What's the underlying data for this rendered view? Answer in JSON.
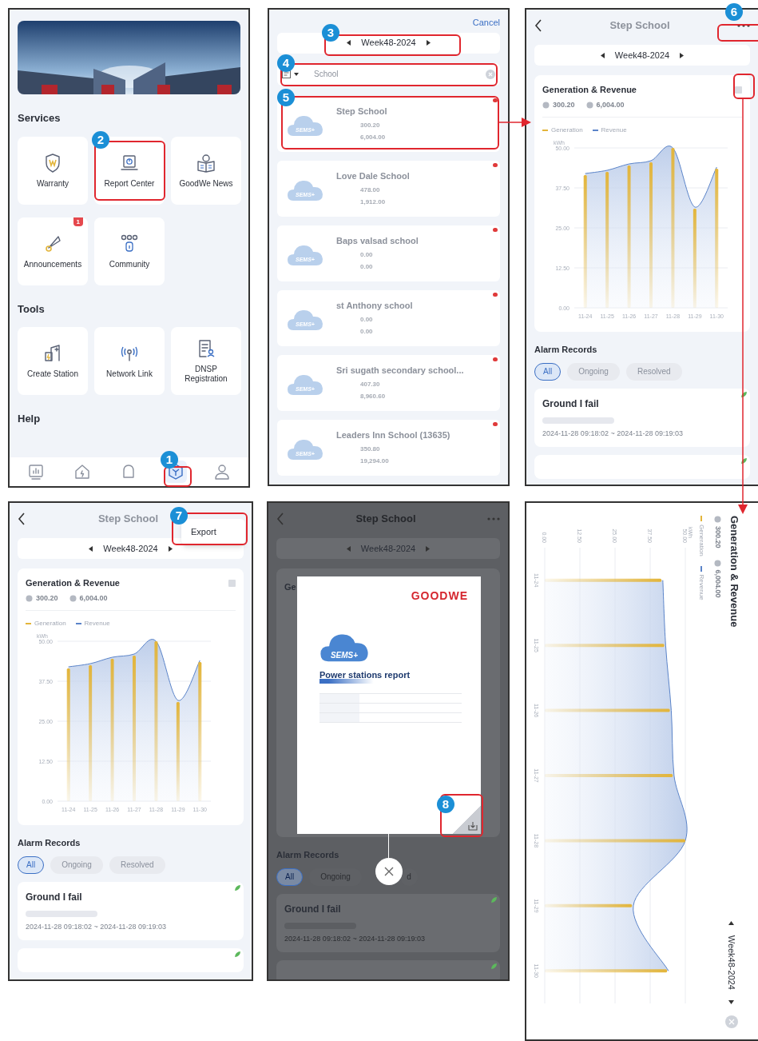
{
  "screens": [
    {
      "kind": "services",
      "banner": {
        "kind": "picture"
      },
      "sections": [
        {
          "title": "Services",
          "tiles": [
            {
              "label": "Warranty"
            },
            {
              "label": "Report Center"
            },
            {
              "label": "GoodWe News"
            },
            {
              "label": "Announcements",
              "badge": "1"
            },
            {
              "label": "Community"
            }
          ]
        },
        {
          "title": "Tools",
          "tiles": [
            {
              "label": "Create Station"
            },
            {
              "label": "Network Link"
            },
            {
              "label": "DNSP Registration"
            }
          ]
        },
        {
          "title": "Help"
        }
      ],
      "nav": [
        {
          "selected": false
        },
        {
          "selected": false
        },
        {
          "selected": false
        },
        {
          "selected": true
        },
        {
          "selected": false
        }
      ]
    },
    {
      "kind": "station_list",
      "cancel": "Cancel",
      "week": "Week48-2024",
      "search": {
        "value": "School"
      },
      "stations": [
        {
          "logo": "SEMS+",
          "name": "Step School",
          "generation": "300.20",
          "revenue": "6,004.00"
        },
        {
          "logo": "SEMS+",
          "name": "Love Dale School",
          "generation": "478.00",
          "revenue": "1,912.00"
        },
        {
          "logo": "SEMS+",
          "name": "Baps valsad school",
          "generation": "0.00",
          "revenue": "0.00"
        },
        {
          "logo": "SEMS+",
          "name": "st Anthony school",
          "generation": "0.00",
          "revenue": "0.00"
        },
        {
          "logo": "SEMS+",
          "name": "Sri sugath secondary school...",
          "generation": "407.30",
          "revenue": "8,960.60"
        },
        {
          "logo": "SEMS+",
          "name": "Leaders Inn School (13635)",
          "generation": "350.80",
          "revenue": "19,294.00"
        }
      ]
    },
    {
      "kind": "detail",
      "title": "Step School",
      "week": "Week48-2024",
      "card": {
        "title": "Generation & Revenue",
        "totals": [
          "300.20",
          "6,004.00"
        ],
        "chart_data": {
          "type": "bar",
          "grid": true,
          "ylabel": "kWh",
          "categories": [
            "11-24",
            "11-25",
            "11-26",
            "11-27",
            "11-28",
            "11-29",
            "11-30"
          ],
          "series": [
            {
              "name": "Generation",
              "type": "bar",
              "color": "#e3b53a",
              "values": [
                41.5,
                42.5,
                44.5,
                45.5,
                50,
                31,
                43.5
              ]
            },
            {
              "name": "Revenue",
              "type": "area",
              "color": "#5b84c9",
              "values": [
                42,
                43,
                45,
                46,
                50,
                31.5,
                44
              ]
            }
          ],
          "ylim": [
            0,
            50
          ],
          "yticks": [
            {
              "value": 0,
              "label": "0.00"
            },
            {
              "value": 12.5,
              "label": "12.50"
            },
            {
              "value": 25,
              "label": "25.00"
            },
            {
              "value": 37.5,
              "label": "37.50"
            },
            {
              "value": 50,
              "label": "50.00"
            }
          ]
        }
      },
      "alarms": {
        "title": "Alarm Records",
        "filters": [
          {
            "label": "All",
            "selected": true
          },
          {
            "label": "Ongoing",
            "selected": false
          },
          {
            "label": "Resolved",
            "selected": false
          }
        ],
        "records": [
          {
            "title": "Ground I fail",
            "time": "2024-11-28 09:18:02 ~ 2024-11-28 09:19:03"
          }
        ]
      }
    },
    {
      "kind": "detail",
      "title": "Step School",
      "week": "Week48-2024",
      "menu": [
        "Export"
      ],
      "card": {
        "title": "Generation & Revenue",
        "totals": [
          "300.20",
          "6,004.00"
        ],
        "chart_data": {
          "type": "bar",
          "grid": true,
          "ylabel": "kWh",
          "categories": [
            "11-24",
            "11-25",
            "11-26",
            "11-27",
            "11-28",
            "11-29",
            "11-30"
          ],
          "series": [
            {
              "name": "Generation",
              "type": "bar",
              "color": "#e3b53a",
              "values": [
                41.5,
                42.5,
                44.5,
                45.5,
                50,
                31,
                43.5
              ]
            },
            {
              "name": "Revenue",
              "type": "area",
              "color": "#5b84c9",
              "values": [
                42,
                43,
                45,
                46,
                50,
                31.5,
                44
              ]
            }
          ],
          "ylim": [
            0,
            50
          ],
          "yticks": [
            {
              "value": 0,
              "label": "0.00"
            },
            {
              "value": 12.5,
              "label": "12.50"
            },
            {
              "value": 25,
              "label": "25.00"
            },
            {
              "value": 37.5,
              "label": "37.50"
            },
            {
              "value": 50,
              "label": "50.00"
            }
          ]
        }
      },
      "alarms": {
        "title": "Alarm Records",
        "filters": [
          {
            "label": "All",
            "selected": true
          },
          {
            "label": "Ongoing",
            "selected": false
          },
          {
            "label": "Resolved",
            "selected": false
          }
        ],
        "records": [
          {
            "title": "Ground I fail",
            "time": "2024-11-28 09:18:02 ~ 2024-11-28 09:19:03"
          }
        ]
      }
    },
    {
      "kind": "report_preview",
      "title": "Step School",
      "week": "Week48-2024",
      "card_title": "Ge",
      "alarms": {
        "title": "Alarm Records",
        "filters": [
          {
            "label": "All",
            "selected": true
          },
          {
            "label": "Ongoing",
            "selected": false
          },
          {
            "label": "d",
            "selected": false
          }
        ],
        "records": [
          {
            "title": "Ground I fail",
            "time": "2024-11-28 09:18:02 ~ 2024-11-28 09:19:03"
          }
        ]
      },
      "modal": {
        "logo": "GOODWE",
        "badge": "SEMS+",
        "title": "Power stations report"
      }
    },
    {
      "kind": "landscape_chart",
      "title": "Generation & Revenue",
      "totals": [
        "300.20",
        "6,004.00"
      ],
      "week": "Week48-2024",
      "chart_data": {
        "type": "bar",
        "orientation": "horizontal",
        "grid": true,
        "ylabel": "kWh",
        "categories": [
          "11-24",
          "11-25",
          "11-26",
          "11-27",
          "11-28",
          "11-29",
          "11-30"
        ],
        "series": [
          {
            "name": "Generation",
            "type": "bar",
            "color": "#e3b53a",
            "values": [
              41.5,
              42.5,
              44.5,
              45.5,
              50,
              31,
              43.5
            ]
          },
          {
            "name": "Revenue",
            "type": "area",
            "color": "#5b84c9",
            "values": [
              42,
              43,
              45,
              46,
              50,
              31.5,
              44
            ]
          }
        ],
        "xlim": [
          0,
          50
        ],
        "xticks": [
          {
            "value": 0,
            "label": "0.00"
          },
          {
            "value": 12.5,
            "label": "12.50"
          },
          {
            "value": 25,
            "label": "25.00"
          },
          {
            "value": 37.5,
            "label": "37.50"
          },
          {
            "value": 50,
            "label": "50.00"
          }
        ]
      }
    }
  ],
  "callouts": [
    {
      "number": "1"
    },
    {
      "number": "2"
    },
    {
      "number": "3"
    },
    {
      "number": "4"
    },
    {
      "number": "5"
    },
    {
      "number": "6"
    },
    {
      "number": "7"
    },
    {
      "number": "8"
    }
  ]
}
